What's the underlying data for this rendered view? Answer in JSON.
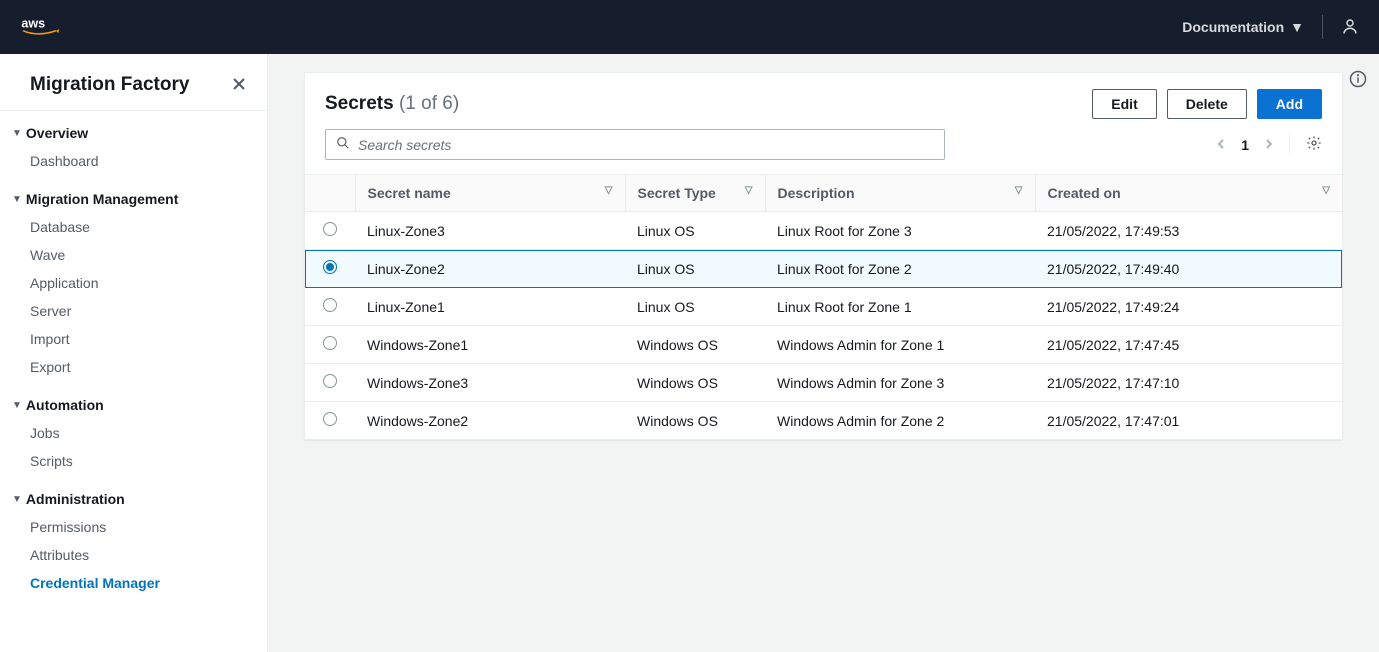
{
  "header": {
    "documentation_label": "Documentation"
  },
  "sidebar": {
    "title": "Migration Factory",
    "groups": [
      {
        "label": "Overview",
        "items": [
          {
            "label": "Dashboard",
            "active": false
          }
        ]
      },
      {
        "label": "Migration Management",
        "items": [
          {
            "label": "Database",
            "active": false
          },
          {
            "label": "Wave",
            "active": false
          },
          {
            "label": "Application",
            "active": false
          },
          {
            "label": "Server",
            "active": false
          },
          {
            "label": "Import",
            "active": false
          },
          {
            "label": "Export",
            "active": false
          }
        ]
      },
      {
        "label": "Automation",
        "items": [
          {
            "label": "Jobs",
            "active": false
          },
          {
            "label": "Scripts",
            "active": false
          }
        ]
      },
      {
        "label": "Administration",
        "items": [
          {
            "label": "Permissions",
            "active": false
          },
          {
            "label": "Attributes",
            "active": false
          },
          {
            "label": "Credential Manager",
            "active": true
          }
        ]
      }
    ]
  },
  "panel": {
    "title": "Secrets",
    "count": "(1 of 6)",
    "buttons": {
      "edit": "Edit",
      "delete": "Delete",
      "add": "Add"
    },
    "search_placeholder": "Search secrets",
    "page": "1"
  },
  "table": {
    "columns": [
      "Secret name",
      "Secret Type",
      "Description",
      "Created on"
    ],
    "rows": [
      {
        "selected": false,
        "name": "Linux-Zone3",
        "type": "Linux OS",
        "desc": "Linux Root for Zone 3",
        "date": "21/05/2022, 17:49:53"
      },
      {
        "selected": true,
        "name": "Linux-Zone2",
        "type": "Linux OS",
        "desc": "Linux Root for Zone 2",
        "date": "21/05/2022, 17:49:40"
      },
      {
        "selected": false,
        "name": "Linux-Zone1",
        "type": "Linux OS",
        "desc": "Linux Root for Zone 1",
        "date": "21/05/2022, 17:49:24"
      },
      {
        "selected": false,
        "name": "Windows-Zone1",
        "type": "Windows OS",
        "desc": "Windows Admin for Zone 1",
        "date": "21/05/2022, 17:47:45"
      },
      {
        "selected": false,
        "name": "Windows-Zone3",
        "type": "Windows OS",
        "desc": "Windows Admin for Zone 3",
        "date": "21/05/2022, 17:47:10"
      },
      {
        "selected": false,
        "name": "Windows-Zone2",
        "type": "Windows OS",
        "desc": "Windows Admin for Zone 2",
        "date": "21/05/2022, 17:47:01"
      }
    ]
  }
}
